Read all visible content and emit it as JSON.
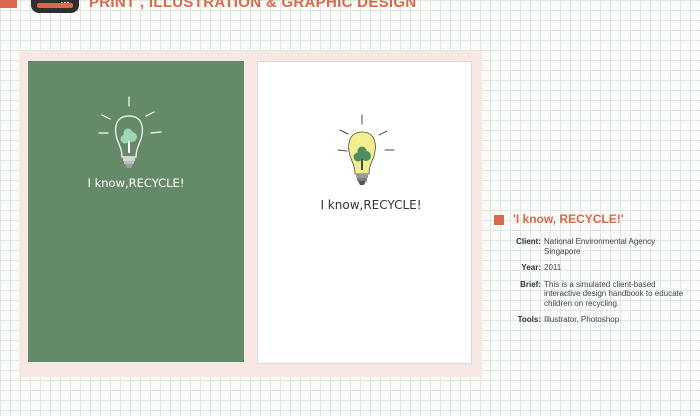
{
  "header": {
    "title": "PRINT , ILLUSTRATION & GRAPHIC DESIGN",
    "device_icon": "laptop-icon",
    "device_dots": "•••"
  },
  "artwork": {
    "slogan": "I know,RECYCLE!",
    "icon": "lightbulb-tree-icon",
    "colors": {
      "green_background": "#648a68",
      "bulb_fill": "#f3ee8f",
      "tree_green": "#4f8c5f"
    }
  },
  "project": {
    "title": "'I know, RECYCLE!'",
    "details": [
      {
        "label": "Client:",
        "value": "National Environmental Agency Singapore"
      },
      {
        "label": "Year:",
        "value": "2011"
      },
      {
        "label": "Brief:",
        "value": "This is a simulated client-based interactive design handbook to educate children on recycling."
      },
      {
        "label": "Tools:",
        "value": "Illustrator, Photoshop"
      }
    ]
  },
  "colors": {
    "accent": "#d9694c",
    "panel": "#f8e8e4",
    "grid": "#dce9df"
  }
}
